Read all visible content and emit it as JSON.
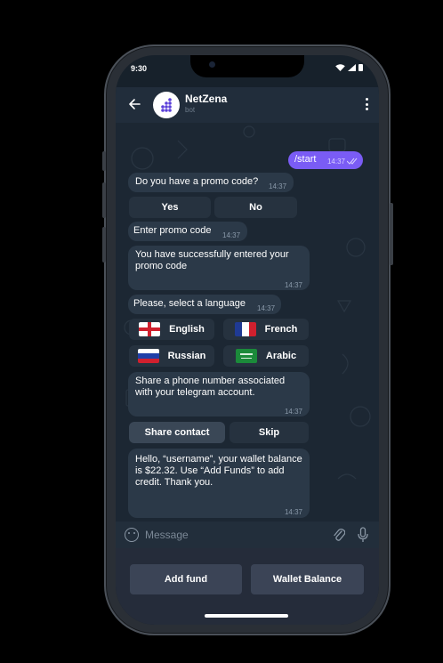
{
  "status": {
    "time": "9:30"
  },
  "header": {
    "name": "NetZena",
    "subtitle": "bot"
  },
  "messages": {
    "start": {
      "text": "/start",
      "time": "14:37"
    },
    "promo_q": {
      "text": "Do you have a promo code?",
      "time": "14:37"
    },
    "promo_yes": "Yes",
    "promo_no": "No",
    "enter_promo": {
      "text": "Enter promo code",
      "time": "14:37"
    },
    "promo_ok": {
      "text": "You have successfully entered your promo code",
      "time": "14:37"
    },
    "lang_q": {
      "text": "Please, select a language",
      "time": "14:37"
    },
    "languages": [
      "English",
      "French",
      "Russian",
      "Arabic"
    ],
    "phone_q": {
      "text": "Share a phone number associated with your telegram account.",
      "time": "14:37"
    },
    "share_contact": "Share contact",
    "skip": "Skip",
    "balance": {
      "text": "Hello, “username”, your wallet balance is $22.32. Use “Add Funds” to add credit. Thank you.",
      "time": "14:37"
    }
  },
  "input": {
    "placeholder": "Message"
  },
  "bottom_buttons": {
    "add_fund": "Add fund",
    "wallet_balance": "Wallet Balance"
  },
  "colors": {
    "accent": "#7a5cf5",
    "bubble": "#2b3948",
    "background": "#17212b"
  },
  "icons": [
    "back-arrow-icon",
    "bot-logo-icon",
    "more-vert-icon",
    "emoji-icon",
    "attach-icon",
    "mic-icon",
    "read-ticks-icon",
    "wifi-icon",
    "signal-icon",
    "battery-icon"
  ]
}
